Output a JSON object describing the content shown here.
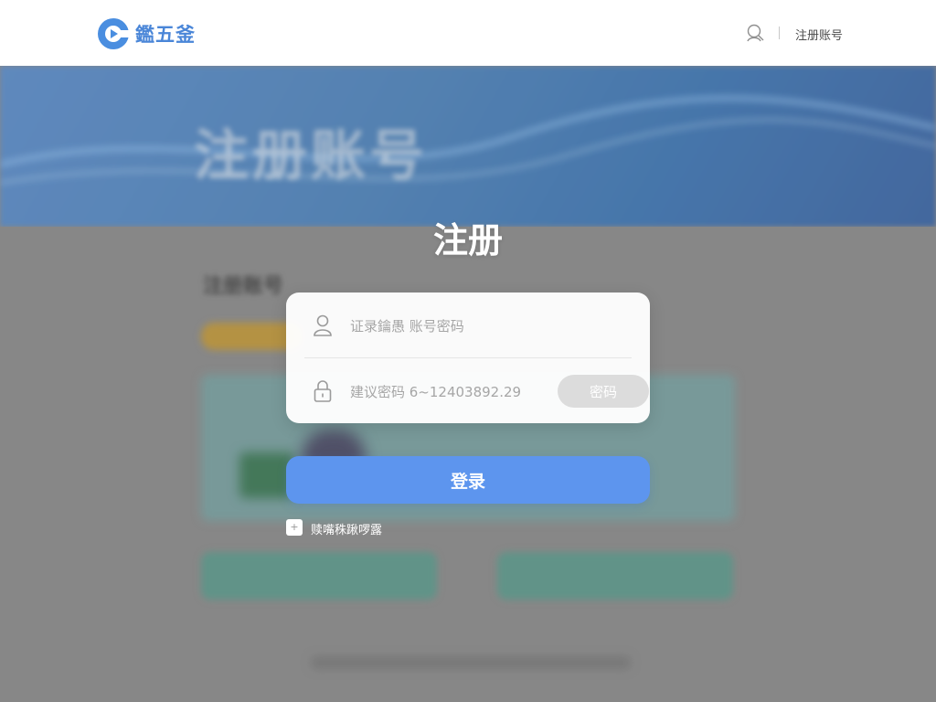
{
  "header": {
    "brand": "鑑五釜",
    "register_link": "注册账号",
    "icons": {
      "logo": "logo-icon",
      "search": "search-icon"
    }
  },
  "background": {
    "banner_title": "注册账号",
    "section_heading": "注册账号"
  },
  "modal": {
    "title": "注册",
    "account_field": {
      "placeholder": "证录鑰愚 账号密码",
      "icon": "user-icon"
    },
    "password_field": {
      "placeholder": "建议密码 6~12403892.29",
      "icon": "lock-icon",
      "button_label": "密码"
    },
    "login_button": "登录",
    "agree": {
      "checkbox_symbol": "+",
      "label": "赎嘴秼踿啰露"
    }
  },
  "colors": {
    "primary": "#5d95ee",
    "brand_blue": "#4a86d8",
    "banner": "#4f86c0",
    "overlay": "#8d8d8d"
  }
}
